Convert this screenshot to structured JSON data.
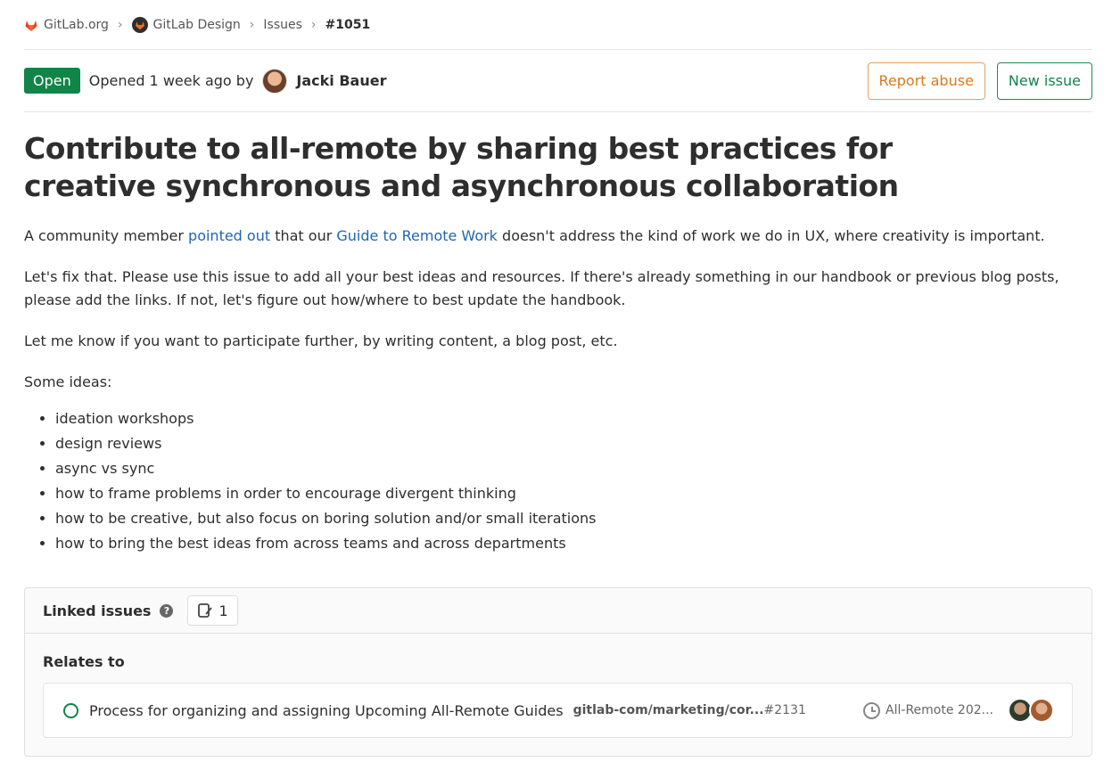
{
  "breadcrumb": {
    "items": [
      "GitLab.org",
      "GitLab Design",
      "Issues"
    ],
    "current": "#1051"
  },
  "header": {
    "status": "Open",
    "opened_text": "Opened 1 week ago by",
    "author": "Jacki Bauer",
    "report_abuse": "Report abuse",
    "new_issue": "New issue"
  },
  "issue": {
    "title": "Contribute to all-remote by sharing best practices for creative synchronous and asynchronous collaboration",
    "p1_a": "A community member ",
    "p1_link1": "pointed out",
    "p1_b": " that our ",
    "p1_link2": "Guide to Remote Work",
    "p1_c": " doesn't address the kind of work we do in UX, where creativity is important.",
    "p2": "Let's fix that. Please use this issue to add all your best ideas and resources. If there's already something in our handbook or previous blog posts, please add the links. If not, let's figure out how/where to best update the handbook.",
    "p3": "Let me know if you want to participate further, by writing content, a blog post, etc.",
    "p4": "Some ideas:",
    "ideas": [
      "ideation workshops",
      "design reviews",
      "async vs sync",
      "how to frame problems in order to encourage divergent thinking",
      "how to be creative, but also focus on boring solution and/or small iterations",
      "how to bring the best ideas from across teams and across departments"
    ]
  },
  "linked": {
    "title": "Linked issues",
    "count": "1",
    "relates_to": "Relates to",
    "item": {
      "title": "Process for organizing and assigning Upcoming All-Remote Guides",
      "path": "gitlab-com/marketing/cor...",
      "ref": "#2131",
      "milestone": "All-Remote 202..."
    }
  },
  "colors": {
    "open_green": "#108548",
    "link_blue": "#1f65b4",
    "abuse_orange": "#d97a1a"
  }
}
